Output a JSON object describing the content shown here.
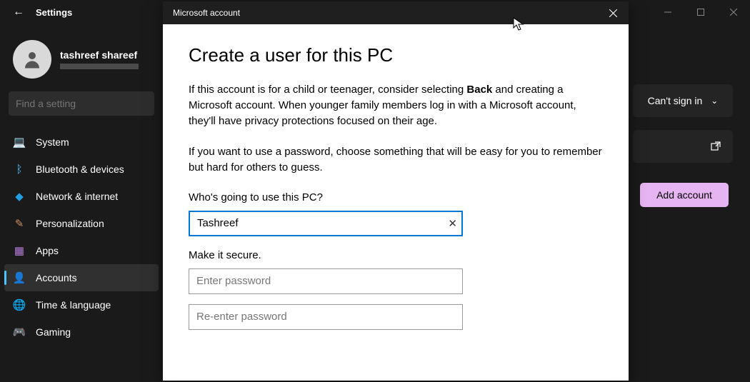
{
  "settings_window": {
    "title": "Settings",
    "profile_name": "tashreef shareef",
    "search_placeholder": "Find a setting",
    "nav": [
      {
        "label": "System",
        "icon": "💻",
        "color": "#4cc2ff"
      },
      {
        "label": "Bluetooth & devices",
        "icon": "ᛒ",
        "color": "#4cc2ff"
      },
      {
        "label": "Network & internet",
        "icon": "◆",
        "color": "#1f9fe0"
      },
      {
        "label": "Personalization",
        "icon": "✎",
        "color": "#c98f5a"
      },
      {
        "label": "Apps",
        "icon": "▦",
        "color": "#b47bd8"
      },
      {
        "label": "Accounts",
        "icon": "👤",
        "color": "#3bc8a2",
        "selected": true
      },
      {
        "label": "Time & language",
        "icon": "🌐",
        "color": "#6bb8d6"
      },
      {
        "label": "Gaming",
        "icon": "🎮",
        "color": "#7ed957"
      }
    ],
    "right_panel": {
      "dropdown_label": "Can't sign in",
      "add_account_label": "Add account"
    }
  },
  "dialog": {
    "title": "Microsoft account",
    "heading": "Create a user for this PC",
    "paragraph1_a": "If this account is for a child or teenager, consider selecting ",
    "paragraph1_bold": "Back",
    "paragraph1_b": " and creating a Microsoft account. When younger family members log in with a Microsoft account, they'll have privacy protections focused on their age.",
    "paragraph2": "If you want to use a password, choose something that will be easy for you to remember but hard for others to guess.",
    "username_label": "Who's going to use this PC?",
    "username_value": "Tashreef",
    "secure_label": "Make it secure.",
    "password_placeholder": "Enter password",
    "password2_placeholder": "Re-enter password"
  }
}
